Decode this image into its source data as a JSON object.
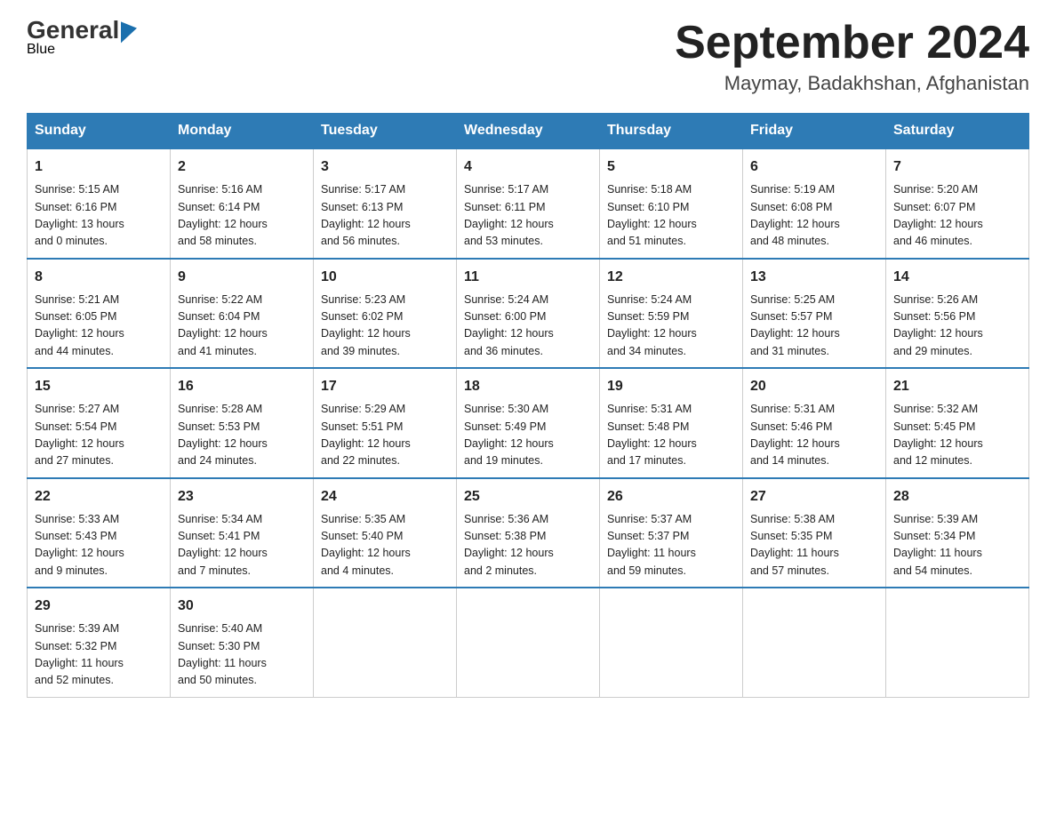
{
  "header": {
    "logo_general": "General",
    "logo_blue": "Blue",
    "month_title": "September 2024",
    "location": "Maymay, Badakhshan, Afghanistan"
  },
  "days_of_week": [
    "Sunday",
    "Monday",
    "Tuesday",
    "Wednesday",
    "Thursday",
    "Friday",
    "Saturday"
  ],
  "weeks": [
    [
      {
        "day": "1",
        "info": "Sunrise: 5:15 AM\nSunset: 6:16 PM\nDaylight: 13 hours\nand 0 minutes."
      },
      {
        "day": "2",
        "info": "Sunrise: 5:16 AM\nSunset: 6:14 PM\nDaylight: 12 hours\nand 58 minutes."
      },
      {
        "day": "3",
        "info": "Sunrise: 5:17 AM\nSunset: 6:13 PM\nDaylight: 12 hours\nand 56 minutes."
      },
      {
        "day": "4",
        "info": "Sunrise: 5:17 AM\nSunset: 6:11 PM\nDaylight: 12 hours\nand 53 minutes."
      },
      {
        "day": "5",
        "info": "Sunrise: 5:18 AM\nSunset: 6:10 PM\nDaylight: 12 hours\nand 51 minutes."
      },
      {
        "day": "6",
        "info": "Sunrise: 5:19 AM\nSunset: 6:08 PM\nDaylight: 12 hours\nand 48 minutes."
      },
      {
        "day": "7",
        "info": "Sunrise: 5:20 AM\nSunset: 6:07 PM\nDaylight: 12 hours\nand 46 minutes."
      }
    ],
    [
      {
        "day": "8",
        "info": "Sunrise: 5:21 AM\nSunset: 6:05 PM\nDaylight: 12 hours\nand 44 minutes."
      },
      {
        "day": "9",
        "info": "Sunrise: 5:22 AM\nSunset: 6:04 PM\nDaylight: 12 hours\nand 41 minutes."
      },
      {
        "day": "10",
        "info": "Sunrise: 5:23 AM\nSunset: 6:02 PM\nDaylight: 12 hours\nand 39 minutes."
      },
      {
        "day": "11",
        "info": "Sunrise: 5:24 AM\nSunset: 6:00 PM\nDaylight: 12 hours\nand 36 minutes."
      },
      {
        "day": "12",
        "info": "Sunrise: 5:24 AM\nSunset: 5:59 PM\nDaylight: 12 hours\nand 34 minutes."
      },
      {
        "day": "13",
        "info": "Sunrise: 5:25 AM\nSunset: 5:57 PM\nDaylight: 12 hours\nand 31 minutes."
      },
      {
        "day": "14",
        "info": "Sunrise: 5:26 AM\nSunset: 5:56 PM\nDaylight: 12 hours\nand 29 minutes."
      }
    ],
    [
      {
        "day": "15",
        "info": "Sunrise: 5:27 AM\nSunset: 5:54 PM\nDaylight: 12 hours\nand 27 minutes."
      },
      {
        "day": "16",
        "info": "Sunrise: 5:28 AM\nSunset: 5:53 PM\nDaylight: 12 hours\nand 24 minutes."
      },
      {
        "day": "17",
        "info": "Sunrise: 5:29 AM\nSunset: 5:51 PM\nDaylight: 12 hours\nand 22 minutes."
      },
      {
        "day": "18",
        "info": "Sunrise: 5:30 AM\nSunset: 5:49 PM\nDaylight: 12 hours\nand 19 minutes."
      },
      {
        "day": "19",
        "info": "Sunrise: 5:31 AM\nSunset: 5:48 PM\nDaylight: 12 hours\nand 17 minutes."
      },
      {
        "day": "20",
        "info": "Sunrise: 5:31 AM\nSunset: 5:46 PM\nDaylight: 12 hours\nand 14 minutes."
      },
      {
        "day": "21",
        "info": "Sunrise: 5:32 AM\nSunset: 5:45 PM\nDaylight: 12 hours\nand 12 minutes."
      }
    ],
    [
      {
        "day": "22",
        "info": "Sunrise: 5:33 AM\nSunset: 5:43 PM\nDaylight: 12 hours\nand 9 minutes."
      },
      {
        "day": "23",
        "info": "Sunrise: 5:34 AM\nSunset: 5:41 PM\nDaylight: 12 hours\nand 7 minutes."
      },
      {
        "day": "24",
        "info": "Sunrise: 5:35 AM\nSunset: 5:40 PM\nDaylight: 12 hours\nand 4 minutes."
      },
      {
        "day": "25",
        "info": "Sunrise: 5:36 AM\nSunset: 5:38 PM\nDaylight: 12 hours\nand 2 minutes."
      },
      {
        "day": "26",
        "info": "Sunrise: 5:37 AM\nSunset: 5:37 PM\nDaylight: 11 hours\nand 59 minutes."
      },
      {
        "day": "27",
        "info": "Sunrise: 5:38 AM\nSunset: 5:35 PM\nDaylight: 11 hours\nand 57 minutes."
      },
      {
        "day": "28",
        "info": "Sunrise: 5:39 AM\nSunset: 5:34 PM\nDaylight: 11 hours\nand 54 minutes."
      }
    ],
    [
      {
        "day": "29",
        "info": "Sunrise: 5:39 AM\nSunset: 5:32 PM\nDaylight: 11 hours\nand 52 minutes."
      },
      {
        "day": "30",
        "info": "Sunrise: 5:40 AM\nSunset: 5:30 PM\nDaylight: 11 hours\nand 50 minutes."
      },
      {
        "day": "",
        "info": ""
      },
      {
        "day": "",
        "info": ""
      },
      {
        "day": "",
        "info": ""
      },
      {
        "day": "",
        "info": ""
      },
      {
        "day": "",
        "info": ""
      }
    ]
  ]
}
